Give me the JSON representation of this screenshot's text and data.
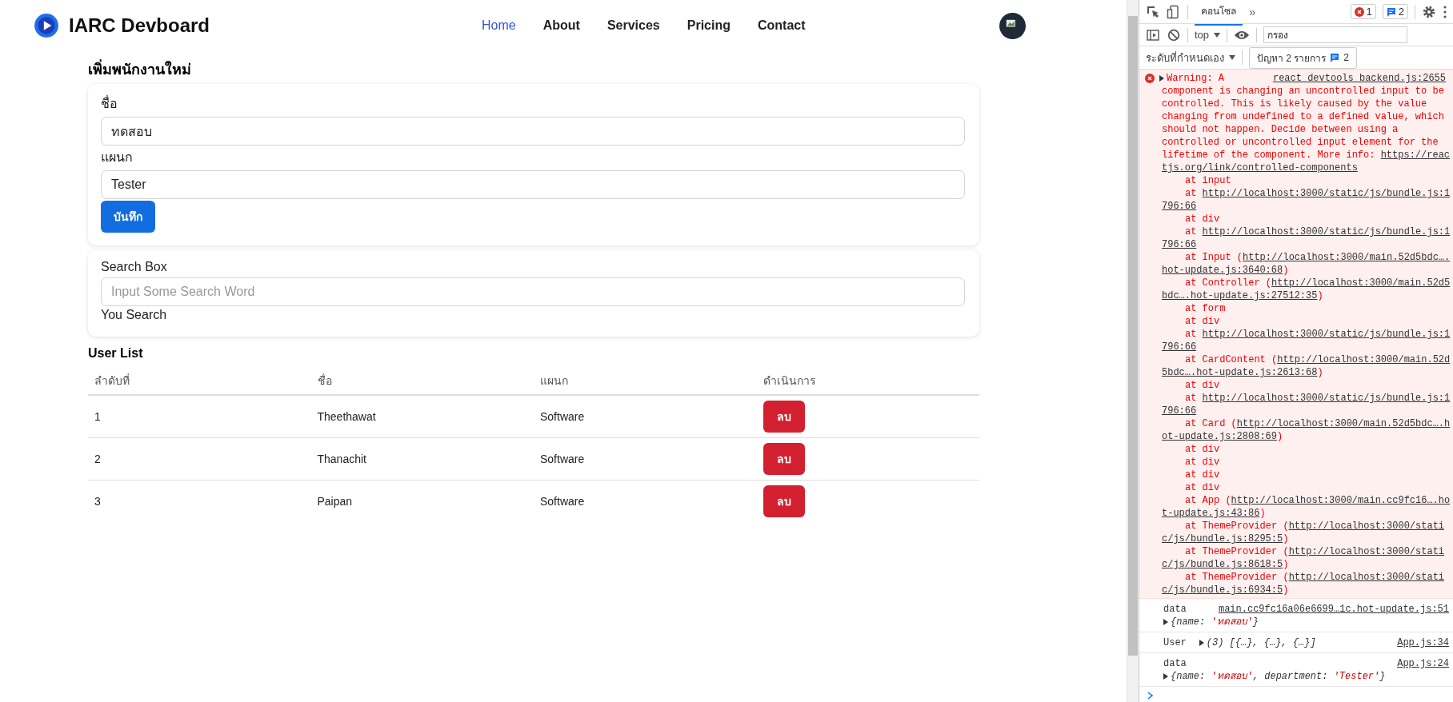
{
  "header": {
    "brand": "IARC Devboard",
    "nav": [
      {
        "label": "Home",
        "selected": true
      },
      {
        "label": "About",
        "selected": false
      },
      {
        "label": "Services",
        "selected": false
      },
      {
        "label": "Pricing",
        "selected": false
      },
      {
        "label": "Contact",
        "selected": false
      }
    ]
  },
  "form": {
    "title": "เพิ่มพนักงานใหม่",
    "fields": [
      {
        "label": "ชื่อ",
        "value": "ทดสอบ"
      },
      {
        "label": "แผนก",
        "value": "Tester"
      }
    ],
    "submit": "บันทึก"
  },
  "search": {
    "label": "Search Box",
    "placeholder": "Input Some Search Word",
    "result_label": "You Search"
  },
  "users": {
    "title": "User List",
    "columns": [
      "ลำดับที่",
      "ชื่อ",
      "แผนก",
      "ดำเนินการ"
    ],
    "rows": [
      {
        "index": "1",
        "name": "Theethawat",
        "department": "Software",
        "action": "ลบ"
      },
      {
        "index": "2",
        "name": "Thanachit",
        "department": "Software",
        "action": "ลบ"
      },
      {
        "index": "3",
        "name": "Paipan",
        "department": "Software",
        "action": "ลบ"
      }
    ]
  },
  "devtools": {
    "tabs": [
      {
        "label": "คอนโซล",
        "selected": true
      }
    ],
    "more": "»",
    "error_count": "1",
    "message_count": "2",
    "context": "top",
    "filter_placeholder": "กรอง",
    "levels": "ระดับที่กำหนดเอง",
    "issues": {
      "label": "ปัญหา 2 รายการ",
      "count": "2"
    },
    "warning": {
      "source": "react_devtools_backend.js:2655",
      "lines": [
        {
          "indent": false,
          "parts": [
            {
              "text": "Warning: A",
              "link": false
            }
          ]
        },
        {
          "indent": false,
          "parts": [
            {
              "text": "component is changing an uncontrolled input to be",
              "link": false
            }
          ]
        },
        {
          "indent": false,
          "parts": [
            {
              "text": "controlled. This is likely caused by the value",
              "link": false
            }
          ]
        },
        {
          "indent": false,
          "parts": [
            {
              "text": "changing from undefined to a defined value, which",
              "link": false
            }
          ]
        },
        {
          "indent": false,
          "parts": [
            {
              "text": "should not happen. Decide between using a",
              "link": false
            }
          ]
        },
        {
          "indent": false,
          "parts": [
            {
              "text": "controlled or uncontrolled input element for the",
              "link": false
            }
          ]
        },
        {
          "indent": false,
          "parts": [
            {
              "text": "lifetime of the component. More info: ",
              "link": false
            },
            {
              "text": "https://reac",
              "link": true
            }
          ]
        },
        {
          "indent": false,
          "parts": [
            {
              "text": "tjs.org/link/controlled-components",
              "link": true
            }
          ]
        },
        {
          "indent": true,
          "parts": [
            {
              "text": "at input",
              "link": false
            }
          ]
        },
        {
          "indent": true,
          "parts": [
            {
              "text": "at ",
              "link": false
            },
            {
              "text": "http://localhost:3000/static/js/bundle.js:1",
              "link": true
            }
          ]
        },
        {
          "indent": false,
          "parts": [
            {
              "text": "796:66",
              "link": true
            }
          ]
        },
        {
          "indent": true,
          "parts": [
            {
              "text": "at div",
              "link": false
            }
          ]
        },
        {
          "indent": true,
          "parts": [
            {
              "text": "at ",
              "link": false
            },
            {
              "text": "http://localhost:3000/static/js/bundle.js:1",
              "link": true
            }
          ]
        },
        {
          "indent": false,
          "parts": [
            {
              "text": "796:66",
              "link": true
            }
          ]
        },
        {
          "indent": true,
          "parts": [
            {
              "text": "at Input (",
              "link": false
            },
            {
              "text": "http://localhost:3000/main.52d5bdc….",
              "link": true
            }
          ]
        },
        {
          "indent": false,
          "parts": [
            {
              "text": "hot-update.js:3640:68",
              "link": true
            },
            {
              "text": ")",
              "link": false
            }
          ]
        },
        {
          "indent": true,
          "parts": [
            {
              "text": "at Controller (",
              "link": false
            },
            {
              "text": "http://localhost:3000/main.52d5",
              "link": true
            }
          ]
        },
        {
          "indent": false,
          "parts": [
            {
              "text": "bdc….hot-update.js:27512:35",
              "link": true
            },
            {
              "text": ")",
              "link": false
            }
          ]
        },
        {
          "indent": true,
          "parts": [
            {
              "text": "at form",
              "link": false
            }
          ]
        },
        {
          "indent": true,
          "parts": [
            {
              "text": "at div",
              "link": false
            }
          ]
        },
        {
          "indent": true,
          "parts": [
            {
              "text": "at ",
              "link": false
            },
            {
              "text": "http://localhost:3000/static/js/bundle.js:1",
              "link": true
            }
          ]
        },
        {
          "indent": false,
          "parts": [
            {
              "text": "796:66",
              "link": true
            }
          ]
        },
        {
          "indent": true,
          "parts": [
            {
              "text": "at CardContent (",
              "link": false
            },
            {
              "text": "http://localhost:3000/main.52d",
              "link": true
            }
          ]
        },
        {
          "indent": false,
          "parts": [
            {
              "text": "5bdc….hot-update.js:2613:68",
              "link": true
            },
            {
              "text": ")",
              "link": false
            }
          ]
        },
        {
          "indent": true,
          "parts": [
            {
              "text": "at div",
              "link": false
            }
          ]
        },
        {
          "indent": true,
          "parts": [
            {
              "text": "at ",
              "link": false
            },
            {
              "text": "http://localhost:3000/static/js/bundle.js:1",
              "link": true
            }
          ]
        },
        {
          "indent": false,
          "parts": [
            {
              "text": "796:66",
              "link": true
            }
          ]
        },
        {
          "indent": true,
          "parts": [
            {
              "text": "at Card (",
              "link": false
            },
            {
              "text": "http://localhost:3000/main.52d5bdc….h",
              "link": true
            }
          ]
        },
        {
          "indent": false,
          "parts": [
            {
              "text": "ot-update.js:2808:69",
              "link": true
            },
            {
              "text": ")",
              "link": false
            }
          ]
        },
        {
          "indent": true,
          "parts": [
            {
              "text": "at div",
              "link": false
            }
          ]
        },
        {
          "indent": true,
          "parts": [
            {
              "text": "at div",
              "link": false
            }
          ]
        },
        {
          "indent": true,
          "parts": [
            {
              "text": "at div",
              "link": false
            }
          ]
        },
        {
          "indent": true,
          "parts": [
            {
              "text": "at div",
              "link": false
            }
          ]
        },
        {
          "indent": true,
          "parts": [
            {
              "text": "at App (",
              "link": false
            },
            {
              "text": "http://localhost:3000/main.cc9fc16….ho",
              "link": true
            }
          ]
        },
        {
          "indent": false,
          "parts": [
            {
              "text": "t-update.js:43:86",
              "link": true
            },
            {
              "text": ")",
              "link": false
            }
          ]
        },
        {
          "indent": true,
          "parts": [
            {
              "text": "at ThemeProvider (",
              "link": false
            },
            {
              "text": "http://localhost:3000/stati",
              "link": true
            }
          ]
        },
        {
          "indent": false,
          "parts": [
            {
              "text": "c/js/bundle.js:8295:5",
              "link": true
            },
            {
              "text": ")",
              "link": false
            }
          ]
        },
        {
          "indent": true,
          "parts": [
            {
              "text": "at ThemeProvider (",
              "link": false
            },
            {
              "text": "http://localhost:3000/stati",
              "link": true
            }
          ]
        },
        {
          "indent": false,
          "parts": [
            {
              "text": "c/js/bundle.js:8618:5",
              "link": true
            },
            {
              "text": ")",
              "link": false
            }
          ]
        },
        {
          "indent": true,
          "parts": [
            {
              "text": "at ThemeProvider (",
              "link": false
            },
            {
              "text": "http://localhost:3000/stati",
              "link": true
            }
          ]
        },
        {
          "indent": false,
          "parts": [
            {
              "text": "c/js/bundle.js:6934:5",
              "link": true
            },
            {
              "text": ")",
              "link": false
            }
          ]
        }
      ]
    },
    "logs": [
      {
        "kind": "block",
        "label": "data",
        "source": "main.cc9fc16a06e6699…1c.hot-update.js:51",
        "value": [
          {
            "text": "{name: ",
            "kind": "key"
          },
          {
            "text": "'ทดสอบ'",
            "kind": "string"
          },
          {
            "text": "}",
            "kind": "key"
          }
        ]
      },
      {
        "kind": "inline",
        "label": "User",
        "source": "App.js:34",
        "value": [
          {
            "text": "(3) [{…}, {…}, {…}]",
            "kind": "key"
          }
        ]
      },
      {
        "kind": "block",
        "label": "data",
        "source": "App.js:24",
        "value": [
          {
            "text": "{name: ",
            "kind": "key"
          },
          {
            "text": "'ทดสอบ'",
            "kind": "string"
          },
          {
            "text": ", department: ",
            "kind": "key"
          },
          {
            "text": "'Tester'",
            "kind": "string"
          },
          {
            "text": "}",
            "kind": "key"
          }
        ]
      }
    ]
  }
}
